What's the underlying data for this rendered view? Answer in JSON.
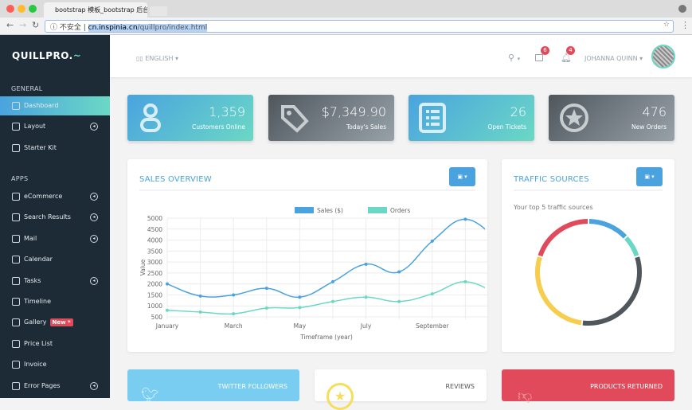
{
  "browser": {
    "tab_title": "bootstrap 模板_bootstrap 后台",
    "security_label": "不安全",
    "url_host": "cn.inspinia.cn",
    "url_path": "/quillpro/index.html"
  },
  "brand": {
    "logo": "QUILLPRO."
  },
  "header": {
    "language": "ENGLISH",
    "messages_count": "6",
    "notifications_count": "4",
    "user_name": "JOHANNA QUINN"
  },
  "sidebar": {
    "general_label": "GENERAL",
    "apps_label": "APPS",
    "general": [
      {
        "label": "Dashboard",
        "active": true
      },
      {
        "label": "Layout",
        "submenu": true
      },
      {
        "label": "Starter Kit"
      }
    ],
    "apps": [
      {
        "label": "eCommerce",
        "submenu": true
      },
      {
        "label": "Search Results",
        "submenu": true
      },
      {
        "label": "Mail",
        "submenu": true
      },
      {
        "label": "Calendar"
      },
      {
        "label": "Tasks",
        "submenu": true
      },
      {
        "label": "Timeline"
      },
      {
        "label": "Gallery",
        "badge": "New *"
      },
      {
        "label": "Price List"
      },
      {
        "label": "Invoice"
      },
      {
        "label": "Error Pages",
        "submenu": true
      }
    ]
  },
  "stats": [
    {
      "value": "1,359",
      "label": "Customers Online",
      "icon": "user-icon"
    },
    {
      "value": "$7,349.90",
      "label": "Today's Sales",
      "icon": "tag-icon"
    },
    {
      "value": "26",
      "label": "Open Tickets",
      "icon": "list-icon"
    },
    {
      "value": "476",
      "label": "New Orders",
      "icon": "star-circle-icon"
    }
  ],
  "sales": {
    "title": "SALES OVERVIEW"
  },
  "traffic": {
    "title": "TRAFFIC SOURCES",
    "subtitle": "Your top 5 traffic sources"
  },
  "bottom": [
    {
      "label": "TWITTER FOLLOWERS"
    },
    {
      "label": "REVIEWS"
    },
    {
      "label": "PRODUCTS RETURNED"
    }
  ],
  "colors": {
    "accent": "#4aa3df",
    "teal": "#6bd8c5",
    "sidebar": "#1d2b36",
    "red": "#e04a5b",
    "yellow": "#f6cd4c",
    "dark": "#4f575d"
  },
  "chart_data": [
    {
      "type": "line",
      "xlabel": "Timeframe (year)",
      "ylabel": "Value",
      "ylim": [
        500,
        5000
      ],
      "yticks": [
        "5000",
        "4500",
        "4000",
        "3500",
        "3000",
        "2500",
        "2000",
        "1500",
        "1000",
        "500"
      ],
      "xticks": [
        "January",
        "March",
        "May",
        "July",
        "September"
      ],
      "x": [
        "January",
        "February",
        "March",
        "April",
        "May",
        "June",
        "July",
        "August",
        "September",
        "October",
        "November"
      ],
      "legend_position": "top",
      "grid": true,
      "series": [
        {
          "name": "Sales ($)",
          "color": "#4aa3df",
          "values": [
            2000,
            1450,
            1500,
            1800,
            1400,
            2100,
            2900,
            2550,
            3950,
            4950,
            3950
          ]
        },
        {
          "name": "Orders",
          "color": "#6bd8c5",
          "values": [
            800,
            720,
            640,
            900,
            920,
            1200,
            1400,
            1200,
            1550,
            2100,
            1500
          ]
        }
      ]
    },
    {
      "type": "pie",
      "variant": "doughnut",
      "values": [
        13,
        7,
        32,
        28,
        20
      ],
      "colors": [
        "#4aa3df",
        "#6bd8c5",
        "#4f575d",
        "#f6cd4c",
        "#e04a5b"
      ]
    }
  ]
}
